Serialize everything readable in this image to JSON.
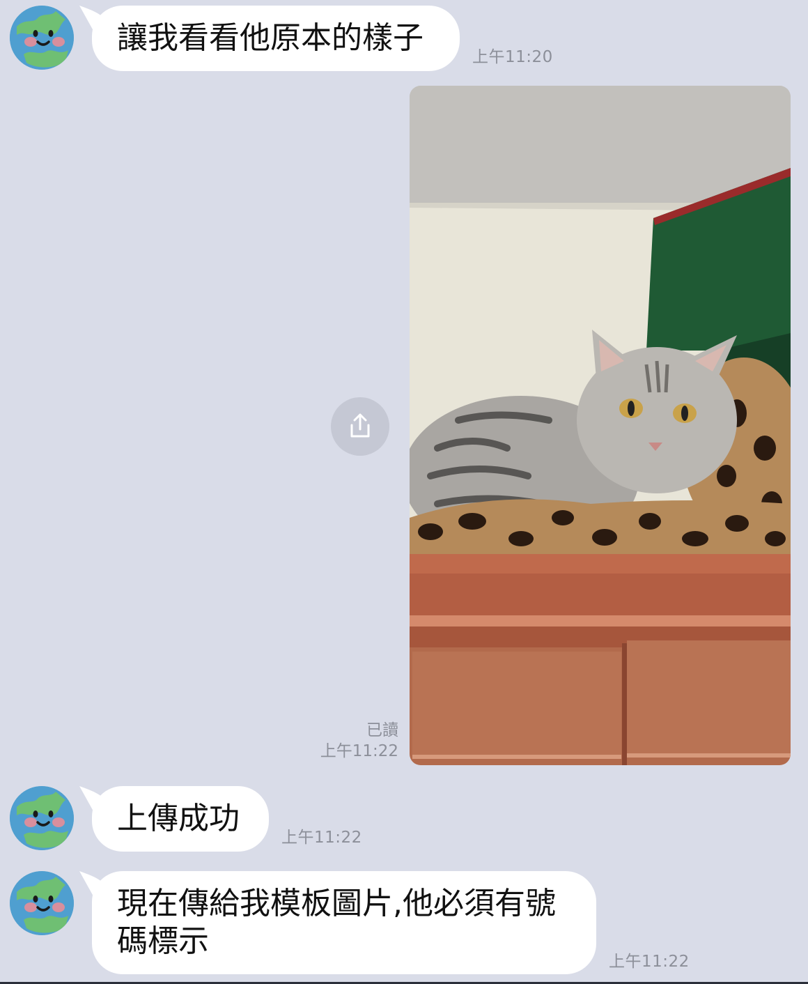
{
  "messages": [
    {
      "text": "讓我看看他原本的樣子",
      "time": "上午11:20"
    },
    {
      "text": "上傳成功",
      "time": "上午11:22"
    },
    {
      "text": "現在傳給我模板圖片,他必須有號\n碼標示",
      "time": "上午11:22"
    }
  ],
  "sent_image": {
    "read_label": "已讀",
    "time": "上午11:22"
  },
  "icons": {
    "share": "share-icon",
    "avatar": "earth-avatar-icon"
  },
  "colors": {
    "background": "#d9dce8",
    "bubble": "#ffffff",
    "timestamp": "#8c8f99"
  }
}
